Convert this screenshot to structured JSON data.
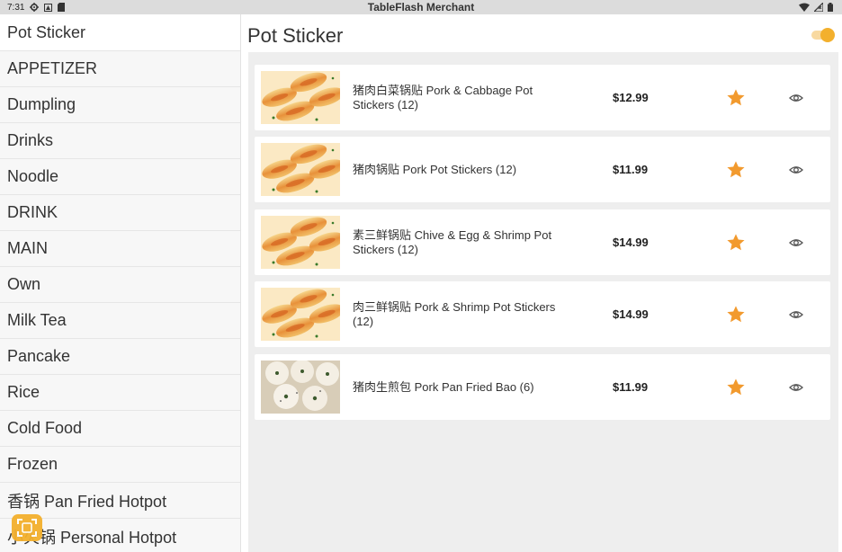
{
  "status_bar": {
    "time": "7:31",
    "app_title": "TableFlash Merchant",
    "left_icons": [
      "gear-icon",
      "notification-icon",
      "sim-card-icon"
    ],
    "right_icons": [
      "wifi-icon",
      "no-signal-icon",
      "battery-icon"
    ]
  },
  "sidebar": {
    "items": [
      {
        "label": "Pot Sticker",
        "active": true
      },
      {
        "label": "APPETIZER"
      },
      {
        "label": "Dumpling"
      },
      {
        "label": "Drinks"
      },
      {
        "label": "Noodle"
      },
      {
        "label": "DRINK"
      },
      {
        "label": "MAIN"
      },
      {
        "label": "Own"
      },
      {
        "label": "Milk Tea"
      },
      {
        "label": "Pancake"
      },
      {
        "label": "Rice"
      },
      {
        "label": "Cold Food"
      },
      {
        "label": "Frozen"
      },
      {
        "label": "香锅 Pan Fried Hotpot"
      },
      {
        "label": "小火锅 Personal Hotpot"
      }
    ]
  },
  "header": {
    "title": "Pot Sticker",
    "toggle_on": true
  },
  "menu_items": [
    {
      "name": "猪肉白菜锅贴 Pork & Cabbage Pot Stickers (12)",
      "price": "$12.99",
      "favorite": true,
      "image": "pot-sticker"
    },
    {
      "name": "猪肉锅贴 Pork Pot Stickers (12)",
      "price": "$11.99",
      "favorite": true,
      "image": "pot-sticker"
    },
    {
      "name": "素三鲜锅贴 Chive & Egg & Shrimp Pot Stickers (12)",
      "price": "$14.99",
      "favorite": true,
      "image": "pot-sticker"
    },
    {
      "name": "肉三鲜锅贴 Pork & Shrimp Pot Stickers (12)",
      "price": "$14.99",
      "favorite": true,
      "image": "pot-sticker"
    },
    {
      "name": "猪肉生煎包 Pork Pan Fried Bao (6)",
      "price": "$11.99",
      "favorite": true,
      "image": "pan-fried-bao"
    }
  ],
  "colors": {
    "accent": "#f3b02d",
    "star": "#f29a2e",
    "status_bar": "#dcdcdc",
    "content_bg": "#eeeeee"
  }
}
